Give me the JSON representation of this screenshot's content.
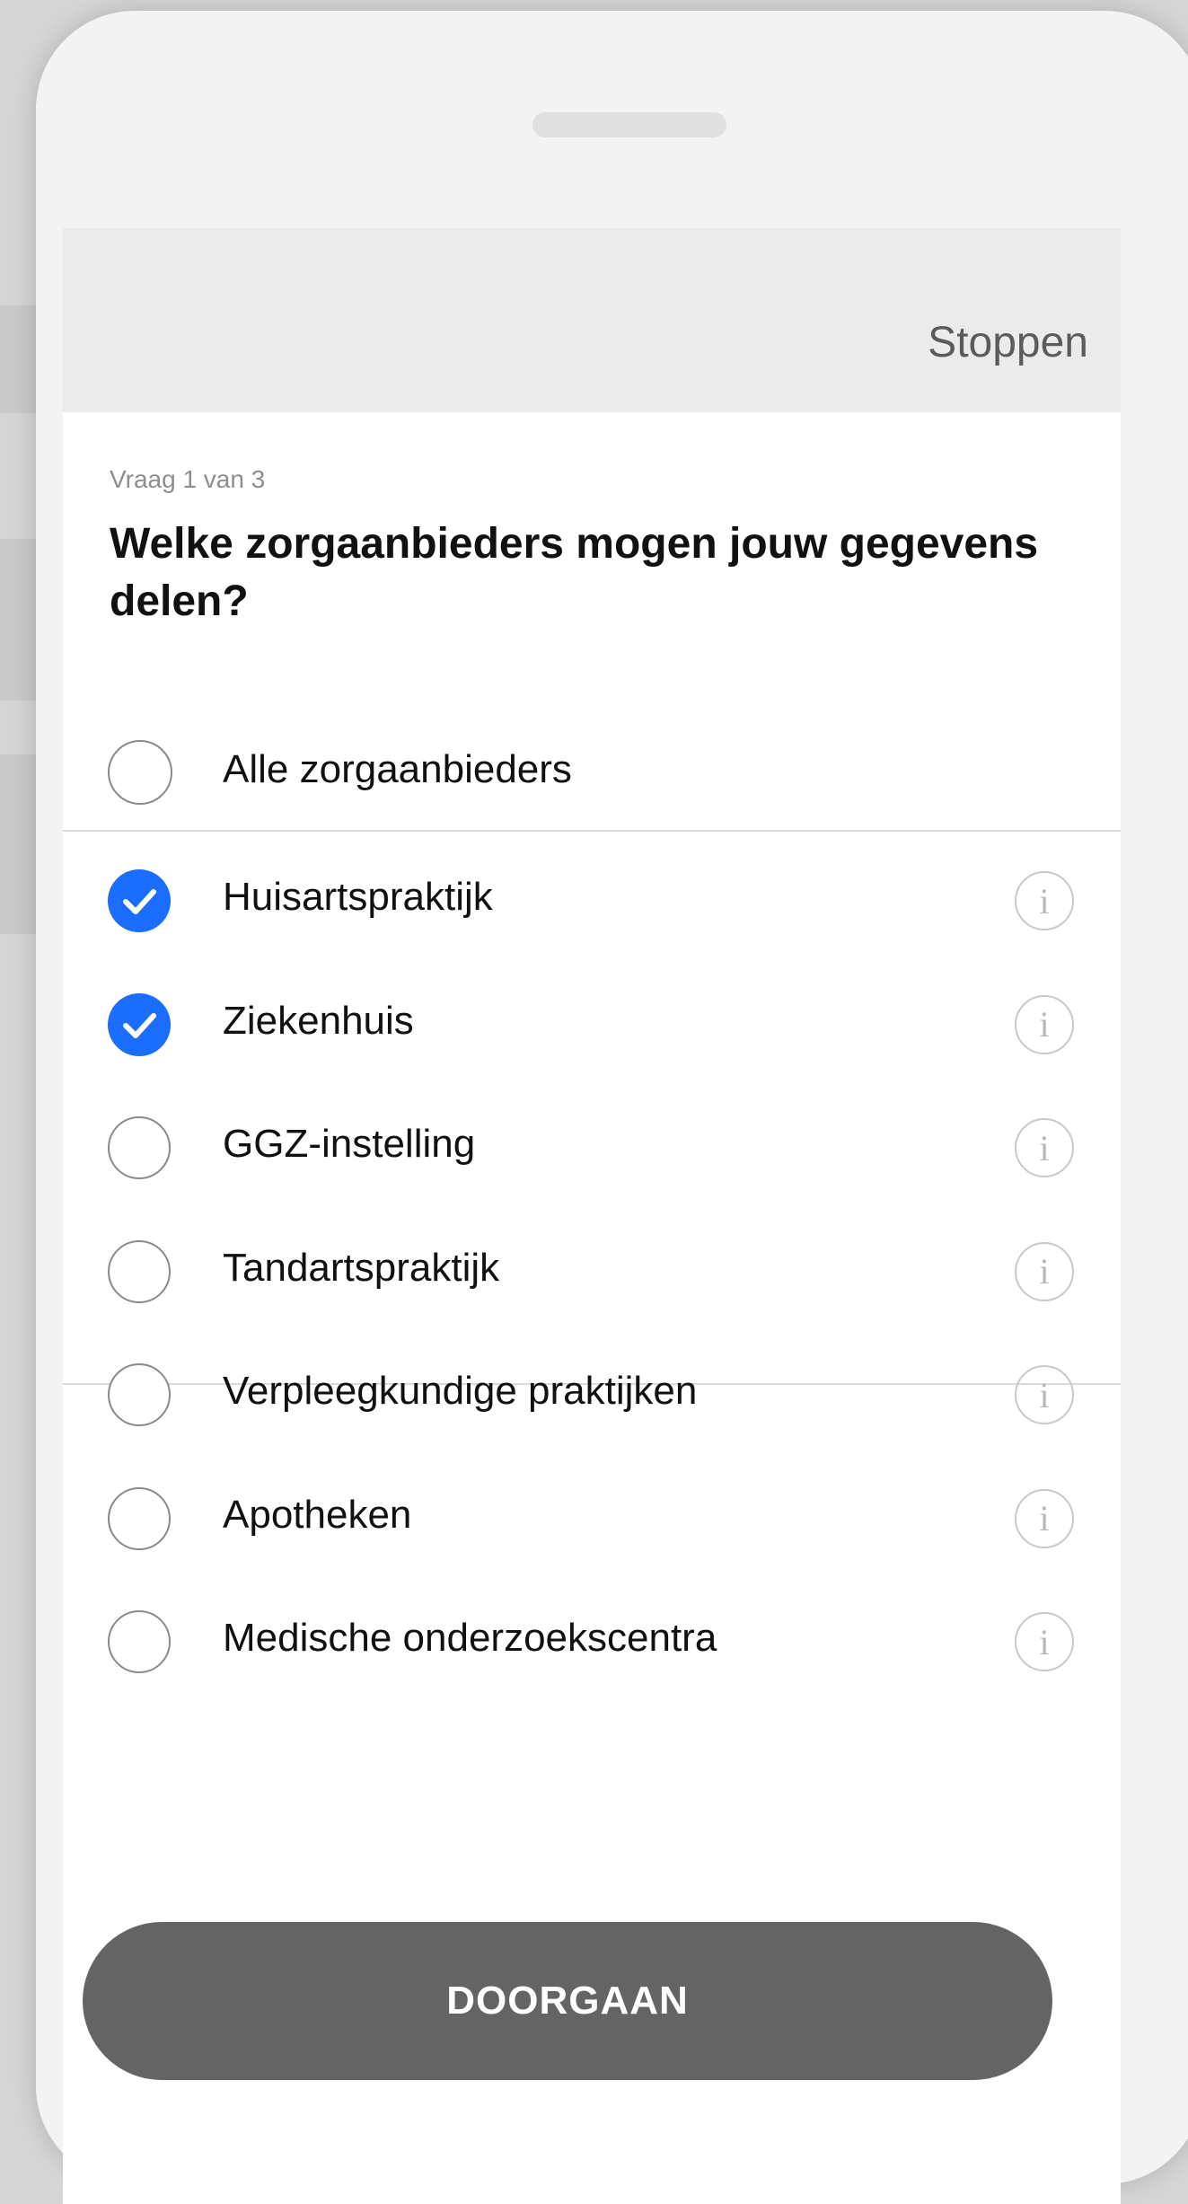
{
  "header": {
    "stop_label": "Stoppen"
  },
  "question": {
    "counter": "Vraag 1 van 3",
    "title": "Welke zorgaanbieders mogen jouw gegevens delen?"
  },
  "all_option": {
    "label": "Alle zorgaanbieders",
    "checked": false
  },
  "options": [
    {
      "label": "Huisartspraktijk",
      "checked": true,
      "info_icon": "info-icon"
    },
    {
      "label": "Ziekenhuis",
      "checked": true,
      "info_icon": "info-icon"
    },
    {
      "label": "GGZ-instelling",
      "checked": false,
      "info_icon": "info-icon"
    },
    {
      "label": "Tandartspraktijk",
      "checked": false,
      "info_icon": "info-icon"
    },
    {
      "label": "Verpleegkundige praktijken",
      "checked": false,
      "info_icon": "info-icon"
    },
    {
      "label": "Apotheken",
      "checked": false,
      "info_icon": "info-icon"
    },
    {
      "label": "Medische onderzoekscentra",
      "checked": false,
      "info_icon": "info-icon"
    }
  ],
  "info_glyph": "i",
  "continue_label": "DOORGAAN",
  "colors": {
    "accent": "#1a6dff",
    "button": "#646464",
    "topbar": "#ebebeb"
  }
}
